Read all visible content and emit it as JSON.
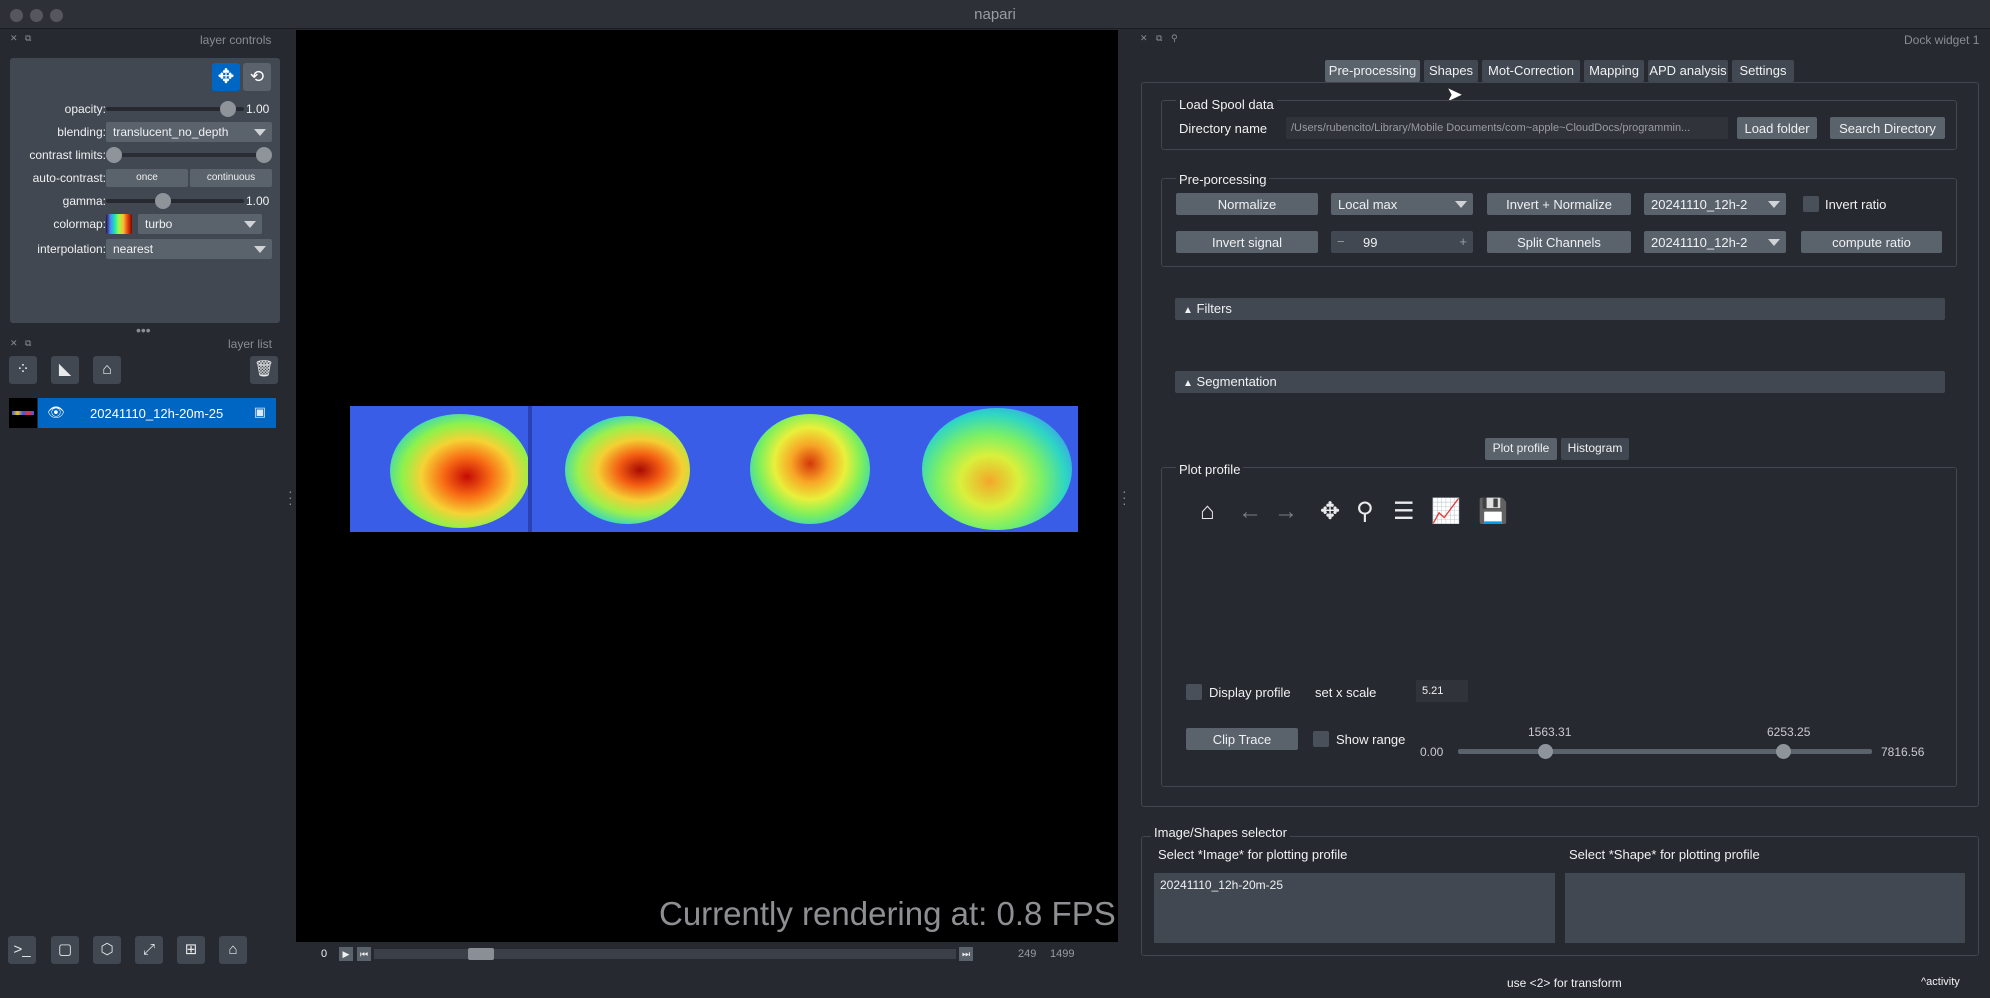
{
  "window": {
    "title": "napari"
  },
  "layer_controls": {
    "panel_title": "layer controls",
    "opacity": {
      "label": "opacity:",
      "value": "1.00",
      "fraction": 1.0
    },
    "blending": {
      "label": "blending:",
      "value": "translucent_no_depth"
    },
    "contrast_limits": {
      "label": "contrast limits:"
    },
    "auto_contrast": {
      "label": "auto-contrast:",
      "once": "once",
      "continuous": "continuous"
    },
    "gamma": {
      "label": "gamma:",
      "value": "1.00"
    },
    "colormap": {
      "label": "colormap:",
      "value": "turbo"
    },
    "interpolation": {
      "label": "interpolation:",
      "value": "nearest"
    }
  },
  "layer_list": {
    "panel_title": "layer list",
    "layers": [
      {
        "name": "20241110_12h-20m-25"
      }
    ]
  },
  "canvas": {
    "fps_text": "Currently rendering at: 0.8 FPS"
  },
  "dims_slider": {
    "current": "0",
    "value": "249",
    "max": "1499"
  },
  "dock": {
    "title": "Dock widget 1",
    "tabs": [
      "Pre-processing",
      "Shapes",
      "Mot-Correction",
      "Mapping",
      "APD analysis",
      "Settings"
    ],
    "load_spool": {
      "title": "Load Spool data",
      "directory_label": "Directory name",
      "directory_value": "/Users/rubencito/Library/Mobile Documents/com~apple~CloudDocs/programmin...",
      "load_folder": "Load folder",
      "search_directory": "Search Directory"
    },
    "preprocessing": {
      "title": "Pre-porcessing",
      "normalize": "Normalize",
      "local_max": "Local max",
      "invert_normalize": "Invert + Normalize",
      "combo1": "20241110_12h-2",
      "invert_ratio": "Invert ratio",
      "invert_signal": "Invert signal",
      "spin_value": "99",
      "spin_minus": "−",
      "spin_plus": "+",
      "split_channels": "Split Channels",
      "combo2": "20241110_12h-2",
      "compute_ratio": "compute ratio"
    },
    "filters": "Filters",
    "segmentation": "Segmentation",
    "plot_tabs": [
      "Plot profile",
      "Histogram"
    ],
    "plot_profile": {
      "title": "Plot profile",
      "display_profile": "Display profile",
      "set_x_scale": "set x scale",
      "x_scale_value": "5.21",
      "clip_trace": "Clip Trace",
      "show_range": "Show range",
      "range_min": "0.00",
      "range_low": "1563.31",
      "range_high": "6253.25",
      "range_max": "7816.56"
    },
    "selector": {
      "title": "Image/Shapes selector",
      "image_label": "Select *Image* for plotting profile",
      "shape_label": "Select *Shape* for plotting profile",
      "images": [
        "20241110_12h-20m-25"
      ]
    }
  },
  "status": {
    "hint": "use <2> for transform",
    "activity": "activity"
  }
}
